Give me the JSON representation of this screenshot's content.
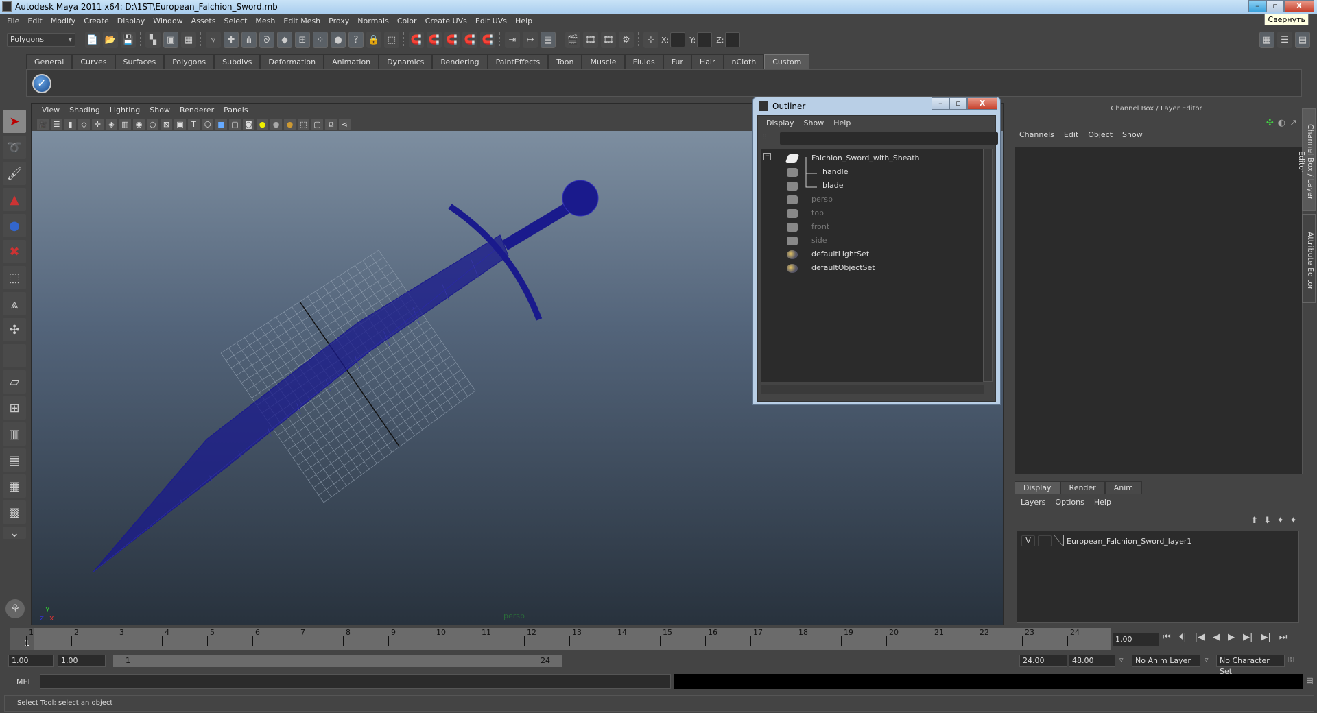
{
  "window": {
    "title": "Autodesk Maya 2011 x64: D:\\1ST\\European_Falchion_Sword.mb",
    "tooltip": "Свернуть",
    "min": "–",
    "restore": "▫",
    "close": "X"
  },
  "menubar": [
    "File",
    "Edit",
    "Modify",
    "Create",
    "Display",
    "Window",
    "Assets",
    "Select",
    "Mesh",
    "Edit Mesh",
    "Proxy",
    "Normals",
    "Color",
    "Create UVs",
    "Edit UVs",
    "Help"
  ],
  "statusline": {
    "mode": "Polygons",
    "x_label": "X:",
    "y_label": "Y:",
    "z_label": "Z:"
  },
  "shelf": {
    "tabs": [
      "General",
      "Curves",
      "Surfaces",
      "Polygons",
      "Subdivs",
      "Deformation",
      "Animation",
      "Dynamics",
      "Rendering",
      "PaintEffects",
      "Toon",
      "Muscle",
      "Fluids",
      "Fur",
      "Hair",
      "nCloth",
      "Custom"
    ],
    "active": "Custom"
  },
  "viewport": {
    "menu": [
      "View",
      "Shading",
      "Lighting",
      "Show",
      "Renderer",
      "Panels"
    ],
    "camera_label": "persp",
    "wire_color": "#1a1a8c",
    "axis_x": "x",
    "axis_y": "y",
    "axis_z": "z"
  },
  "outliner": {
    "title": "Outliner",
    "menu": [
      "Display",
      "Show",
      "Help"
    ],
    "collapse": "−",
    "items": [
      {
        "label": "Falchion_Sword_with_Sheath",
        "type": "group",
        "dim": false
      },
      {
        "label": "handle",
        "type": "mesh",
        "dim": false
      },
      {
        "label": "blade",
        "type": "mesh",
        "dim": false
      },
      {
        "label": "persp",
        "type": "camera",
        "dim": true
      },
      {
        "label": "top",
        "type": "camera",
        "dim": true
      },
      {
        "label": "front",
        "type": "camera",
        "dim": true
      },
      {
        "label": "side",
        "type": "camera",
        "dim": true
      },
      {
        "label": "defaultLightSet",
        "type": "set",
        "dim": false
      },
      {
        "label": "defaultObjectSet",
        "type": "set",
        "dim": false
      }
    ]
  },
  "channelbox": {
    "title": "Channel Box / Layer Editor",
    "menu": [
      "Channels",
      "Edit",
      "Object",
      "Show"
    ]
  },
  "sidetabs": [
    "Channel Box / Layer Editor",
    "Attribute Editor"
  ],
  "layereditor": {
    "tabs": [
      "Display",
      "Render",
      "Anim"
    ],
    "active": "Display",
    "menu": [
      "Layers",
      "Options",
      "Help"
    ],
    "layers": [
      {
        "visible": "V",
        "name": "European_Falchion_Sword_layer1"
      }
    ]
  },
  "timeline": {
    "frames": [
      "1",
      "2",
      "3",
      "4",
      "5",
      "6",
      "7",
      "8",
      "9",
      "10",
      "11",
      "12",
      "13",
      "14",
      "15",
      "16",
      "17",
      "18",
      "19",
      "20",
      "21",
      "22",
      "23",
      "24"
    ],
    "current": "1",
    "current_field": "1.00"
  },
  "range": {
    "start": "1.00",
    "anim_start": "1.00",
    "slider_start": "1",
    "slider_end": "24",
    "end": "24.00",
    "anim_end": "48.00",
    "anim_layer": "No Anim Layer",
    "character_set": "No Character Set"
  },
  "mel": {
    "label": "MEL"
  },
  "helpline": "Select Tool: select an object"
}
